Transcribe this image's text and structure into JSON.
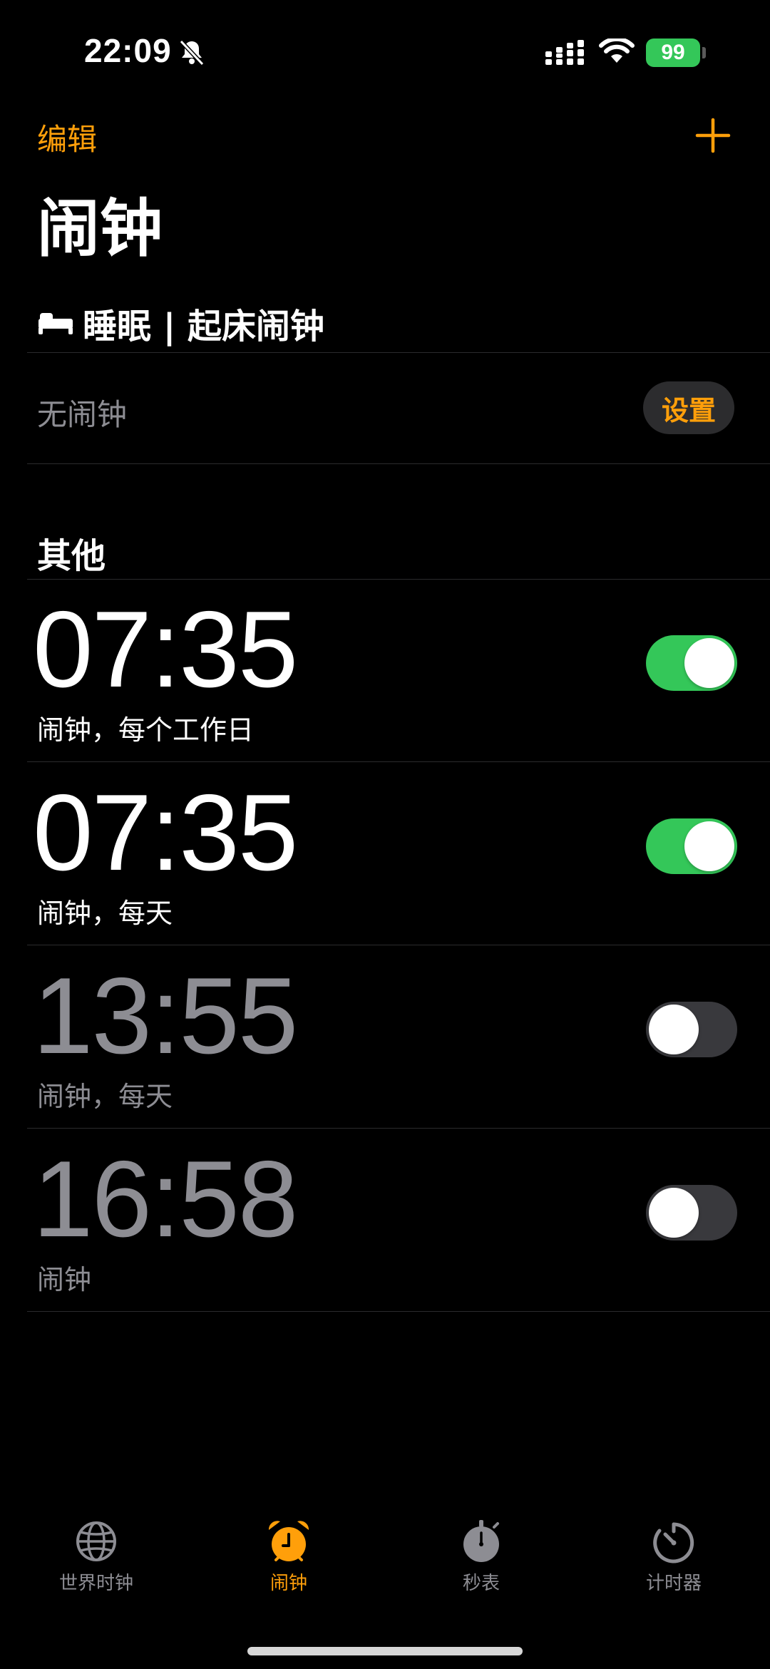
{
  "status_bar": {
    "time": "22:09",
    "battery": "99"
  },
  "nav": {
    "edit_label": "编辑",
    "add_icon": "plus-icon"
  },
  "title": "闹钟",
  "sleep_section": {
    "header": "睡眠 | 起床闹钟",
    "empty_text": "无闹钟",
    "setup_label": "设置"
  },
  "other_section": {
    "header": "其他"
  },
  "alarms": [
    {
      "time": "07:35",
      "label": "闹钟，每个工作日",
      "enabled": true
    },
    {
      "time": "07:35",
      "label": "闹钟，每天",
      "enabled": true
    },
    {
      "time": "13:55",
      "label": "闹钟，每天",
      "enabled": false
    },
    {
      "time": "16:58",
      "label": "闹钟",
      "enabled": false
    }
  ],
  "tabs": [
    {
      "label": "世界时钟",
      "icon": "globe-icon",
      "active": false
    },
    {
      "label": "闹钟",
      "icon": "alarm-clock-icon",
      "active": true
    },
    {
      "label": "秒表",
      "icon": "stopwatch-icon",
      "active": false
    },
    {
      "label": "计时器",
      "icon": "timer-icon",
      "active": false
    }
  ],
  "colors": {
    "accent": "#ff9f0a",
    "toggle_on": "#34c759",
    "background": "#000000",
    "secondary_text": "#8d8d93"
  }
}
